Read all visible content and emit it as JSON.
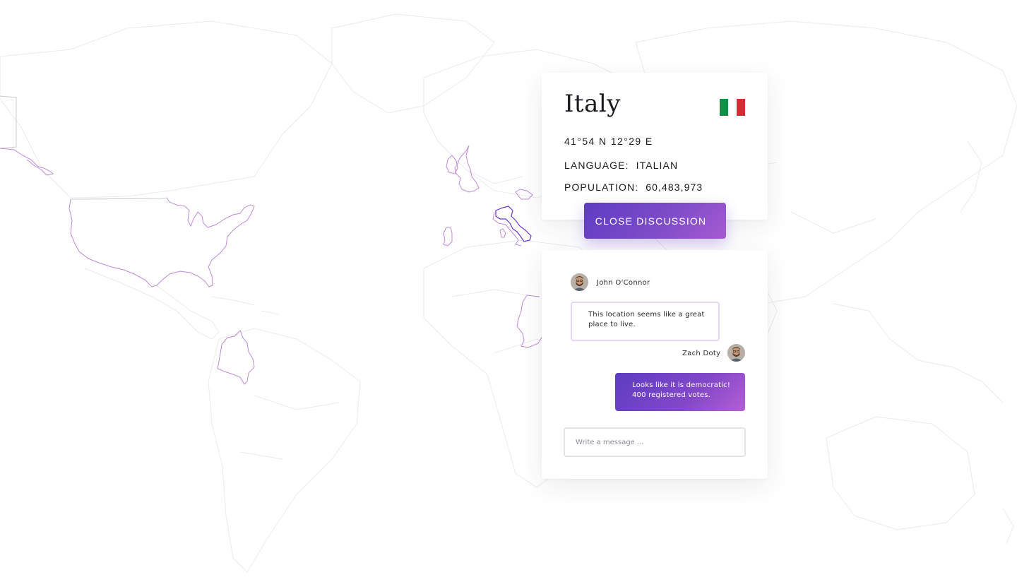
{
  "country": {
    "name": "Italy",
    "coordinates": "41°54 N 12°29 E",
    "language_label": "LANGUAGE:",
    "language_value": "ITALIAN",
    "population_label": "POPULATION:",
    "population_value": "60,483,973",
    "flag_colors": [
      "#0b9248",
      "#ffffff",
      "#d72a35"
    ]
  },
  "actions": {
    "close_discussion_label": "CLOSE DISCUSSION"
  },
  "chat": {
    "messages": [
      {
        "author": "John O'Connor",
        "text": "This location seems like a great place to live.",
        "direction": "incoming"
      },
      {
        "author": "Zach Doty",
        "text": "Looks like it is democratic! 400 registered votes.",
        "direction": "outgoing"
      }
    ],
    "input_placeholder": "Write a message ..."
  },
  "colors": {
    "accent_start": "#5d3cc2",
    "accent_end": "#b35fd4",
    "map_highlight": "#c08ad8",
    "map_land_outline": "#ebebef"
  },
  "icons": {
    "avatar_john": "person-avatar",
    "avatar_zach": "person-avatar"
  }
}
